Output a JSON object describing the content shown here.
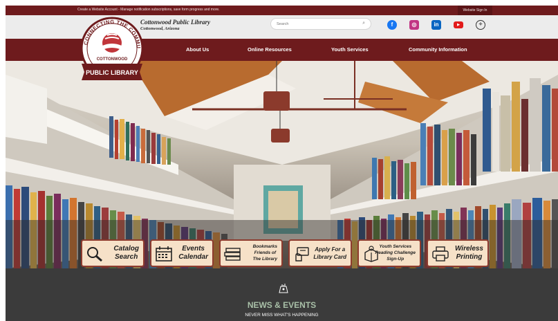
{
  "topbar": {
    "message_part1": "Create a Website Account - ",
    "message_part2": "Manage notification subscriptions, save form progress and more.",
    "signin_label": "Website Sign In"
  },
  "header": {
    "library_name": "Cottonwood Public Library",
    "location": "Cottonwood, Arizona",
    "search_placeholder": "Search"
  },
  "logo": {
    "top_text": "CONNECTING THE COMMUNITY",
    "middle_text": "COTTONWOOD",
    "banner_text": "PUBLIC LIBRARY"
  },
  "social": [
    {
      "name": "facebook-icon",
      "glyph": "f"
    },
    {
      "name": "instagram-icon",
      "glyph": "◎"
    },
    {
      "name": "linkedin-icon",
      "glyph": "in"
    },
    {
      "name": "youtube-icon",
      "glyph": "▶"
    },
    {
      "name": "accessibility-icon",
      "glyph": "✧"
    }
  ],
  "nav": {
    "about": "About Us",
    "resources": "Online Resources",
    "youth": "Youth Services",
    "community": "Community Information"
  },
  "tiles": {
    "catalog": {
      "line1": "Catalog",
      "line2": "Search",
      "icon": "magnifier-icon"
    },
    "events": {
      "line1": "Events",
      "line2": "Calendar",
      "icon": "calendar-icon"
    },
    "bookmarks": {
      "line1": "Bookmarks",
      "line2": "Friends of",
      "line3": "The Library",
      "icon": "books-icon"
    },
    "apply": {
      "line1": "Apply For a",
      "line2": "Library Card",
      "icon": "library-card-icon"
    },
    "youth": {
      "line1": "Youth Services",
      "line2": "Reading Challenge",
      "line3": "Sign-Up",
      "icon": "reading-challenge-icon"
    },
    "printing": {
      "line1": "Wireless",
      "line2": "Printing",
      "icon": "printer-icon"
    }
  },
  "news": {
    "title": "NEWS & EVENTS",
    "subtitle": "NEVER MISS WHAT'S HAPPENING"
  },
  "colors": {
    "brand_maroon": "#6e1b1d",
    "tile_bg": "#f6e1c8",
    "tile_border": "#8e3b2e",
    "news_title": "#a9c0a8",
    "dark_section": "#3b3b3b"
  }
}
